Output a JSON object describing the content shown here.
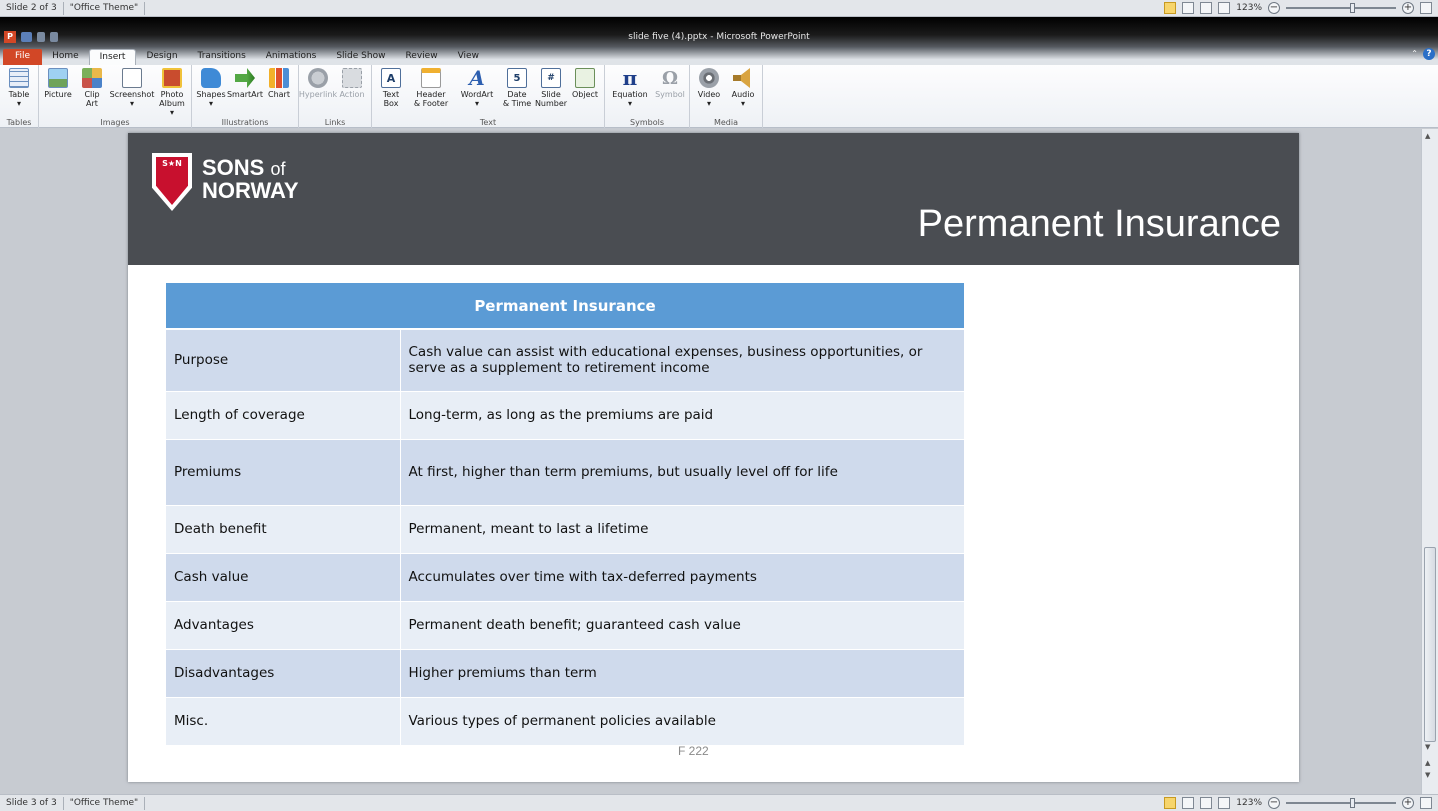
{
  "status_top": {
    "slide": "Slide 2 of 3",
    "theme": "\"Office Theme\"",
    "zoom": "123%"
  },
  "status_bottom": {
    "slide": "Slide 3 of 3",
    "theme": "\"Office Theme\"",
    "zoom": "123%"
  },
  "window": {
    "title": "slide five (4).pptx - Microsoft PowerPoint",
    "app_icon": "P"
  },
  "tabs": [
    "File",
    "Home",
    "Insert",
    "Design",
    "Transitions",
    "Animations",
    "Slide Show",
    "Review",
    "View"
  ],
  "active_tab": "Insert",
  "ribbon": {
    "groups": [
      {
        "label": "Tables",
        "items": [
          {
            "label": "Table\n▾",
            "icon": "table-icon"
          }
        ]
      },
      {
        "label": "Images",
        "items": [
          {
            "label": "Picture",
            "icon": "picture-icon"
          },
          {
            "label": "Clip\nArt",
            "icon": "clip-art-icon"
          },
          {
            "label": "Screenshot\n▾",
            "icon": "screenshot-icon"
          },
          {
            "label": "Photo\nAlbum ▾",
            "icon": "photo-album-icon"
          }
        ]
      },
      {
        "label": "Illustrations",
        "items": [
          {
            "label": "Shapes\n▾",
            "icon": "shapes-icon"
          },
          {
            "label": "SmartArt",
            "icon": "smartart-icon"
          },
          {
            "label": "Chart",
            "icon": "chart-icon"
          }
        ]
      },
      {
        "label": "Links",
        "items": [
          {
            "label": "Hyperlink",
            "icon": "hyperlink-icon"
          },
          {
            "label": "Action",
            "icon": "action-icon"
          }
        ]
      },
      {
        "label": "Text",
        "items": [
          {
            "label": "Text\nBox",
            "icon": "text-box-icon"
          },
          {
            "label": "Header\n& Footer",
            "icon": "header-footer-icon"
          },
          {
            "label": "WordArt\n▾",
            "icon": "wordart-icon"
          },
          {
            "label": "Date\n& Time",
            "icon": "date-time-icon"
          },
          {
            "label": "Slide\nNumber",
            "icon": "slide-number-icon"
          },
          {
            "label": "Object",
            "icon": "object-icon"
          }
        ]
      },
      {
        "label": "Symbols",
        "items": [
          {
            "label": "Equation\n▾",
            "icon": "equation-icon"
          },
          {
            "label": "Symbol",
            "icon": "symbol-icon"
          }
        ]
      },
      {
        "label": "Media",
        "items": [
          {
            "label": "Video\n▾",
            "icon": "video-icon"
          },
          {
            "label": "Audio\n▾",
            "icon": "audio-icon"
          }
        ]
      }
    ],
    "glyphs": {
      "textbox": "A",
      "wordart": "A",
      "datetime": "5",
      "slidenum": "#",
      "equation": "π",
      "symbol": "Ω"
    }
  },
  "slide": {
    "brand_line1": "SONS",
    "brand_of": "of",
    "brand_line2": "NORWAY",
    "shield_mark": "S★N",
    "title": "Permanent Insurance",
    "table_header": "Permanent Insurance",
    "rows": [
      {
        "key": "Purpose",
        "value": "Cash value can assist with educational expenses, business opportunities, or serve as a supplement to retirement income"
      },
      {
        "key": "Length of coverage",
        "value": "Long-term, as long as the premiums are paid"
      },
      {
        "key": "Premiums",
        "value": "At first, higher than term premiums, but usually level off for life"
      },
      {
        "key": "Death benefit",
        "value": "Permanent, meant to last a lifetime"
      },
      {
        "key": "Cash value",
        "value": "Accumulates over time with tax-deferred payments"
      },
      {
        "key": "Advantages",
        "value": "Permanent death benefit; guaranteed cash value"
      },
      {
        "key": "Disadvantages",
        "value": "Higher premiums than term"
      },
      {
        "key": "Misc.",
        "value": "Various types of permanent policies available"
      }
    ],
    "footer": "F 222"
  },
  "colors": {
    "header_bar": "#4a4d52",
    "table_header": "#5b9bd5",
    "row_odd": "#cfdaec",
    "row_even": "#e8eef6",
    "file_tab": "#d24726"
  }
}
